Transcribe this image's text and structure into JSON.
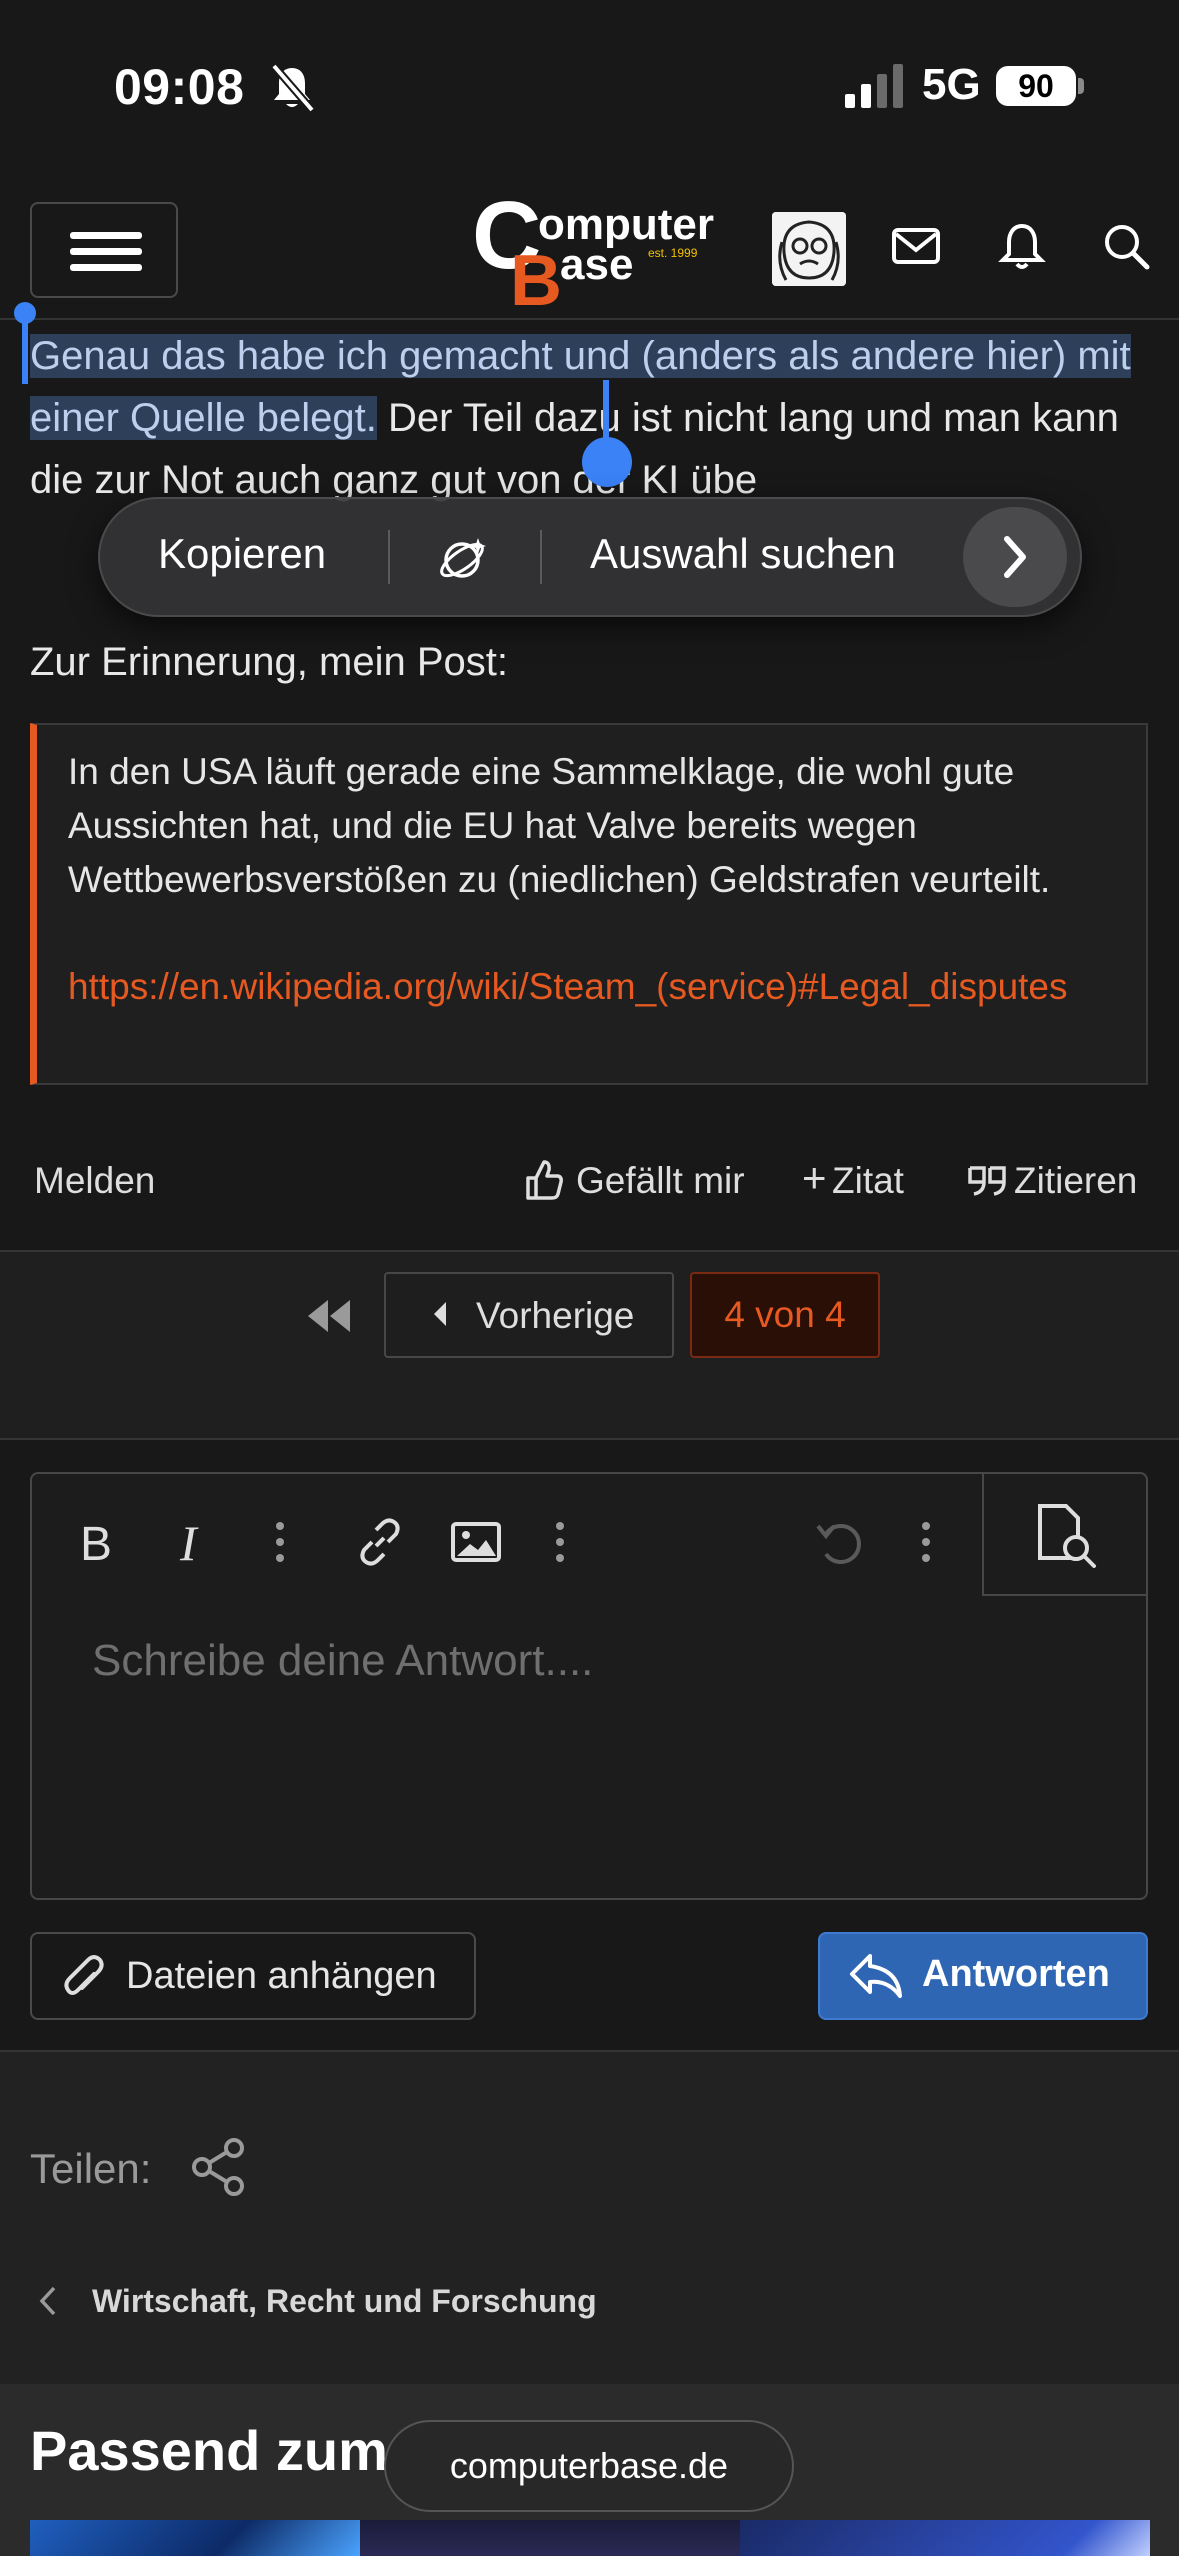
{
  "status_bar": {
    "time": "09:08",
    "network": "5G",
    "battery": "90"
  },
  "header": {
    "logo_text_1": "omputer",
    "logo_text_2": "ase",
    "logo_est": "est. 1999"
  },
  "post": {
    "selected_text": "Genau das habe ich gemacht und (anders als andere hier) mit einer Quelle belegt.",
    "rest_text": " Der Teil dazu ist nicht lang und man kann die zur Not auch ganz gut von der KI übe",
    "reminder": "Zur Erinnerung, mein Post:"
  },
  "context_menu": {
    "copy": "Kopieren",
    "search": "Auswahl suchen"
  },
  "quote": {
    "text": "In den USA läuft gerade eine Sammelklage, die wohl gute Aussichten hat, und die EU hat Valve bereits wegen Wettbewerbsverstößen zu (niedlichen) Geldstrafen veurteilt.",
    "link": "https://en.wikipedia.org/wiki/Steam_(service)#Legal_disputes"
  },
  "actions": {
    "report": "Melden",
    "like": "Gefällt mir",
    "add_quote": "Zitat",
    "quote": "Zitieren"
  },
  "pagination": {
    "prev": "Vorherige",
    "page": "4 von 4"
  },
  "editor": {
    "placeholder": "Schreibe deine Antwort....",
    "attach": "Dateien anhängen",
    "reply": "Antworten"
  },
  "footer": {
    "share": "Teilen:",
    "breadcrumb": "Wirtschaft, Recht und Forschung"
  },
  "related": {
    "title": "Passend zum"
  },
  "browser": {
    "url": "computerbase.de"
  },
  "colors": {
    "accent": "#e65a22",
    "selection": "#3b82f6",
    "reply_button": "#2f66b3"
  }
}
